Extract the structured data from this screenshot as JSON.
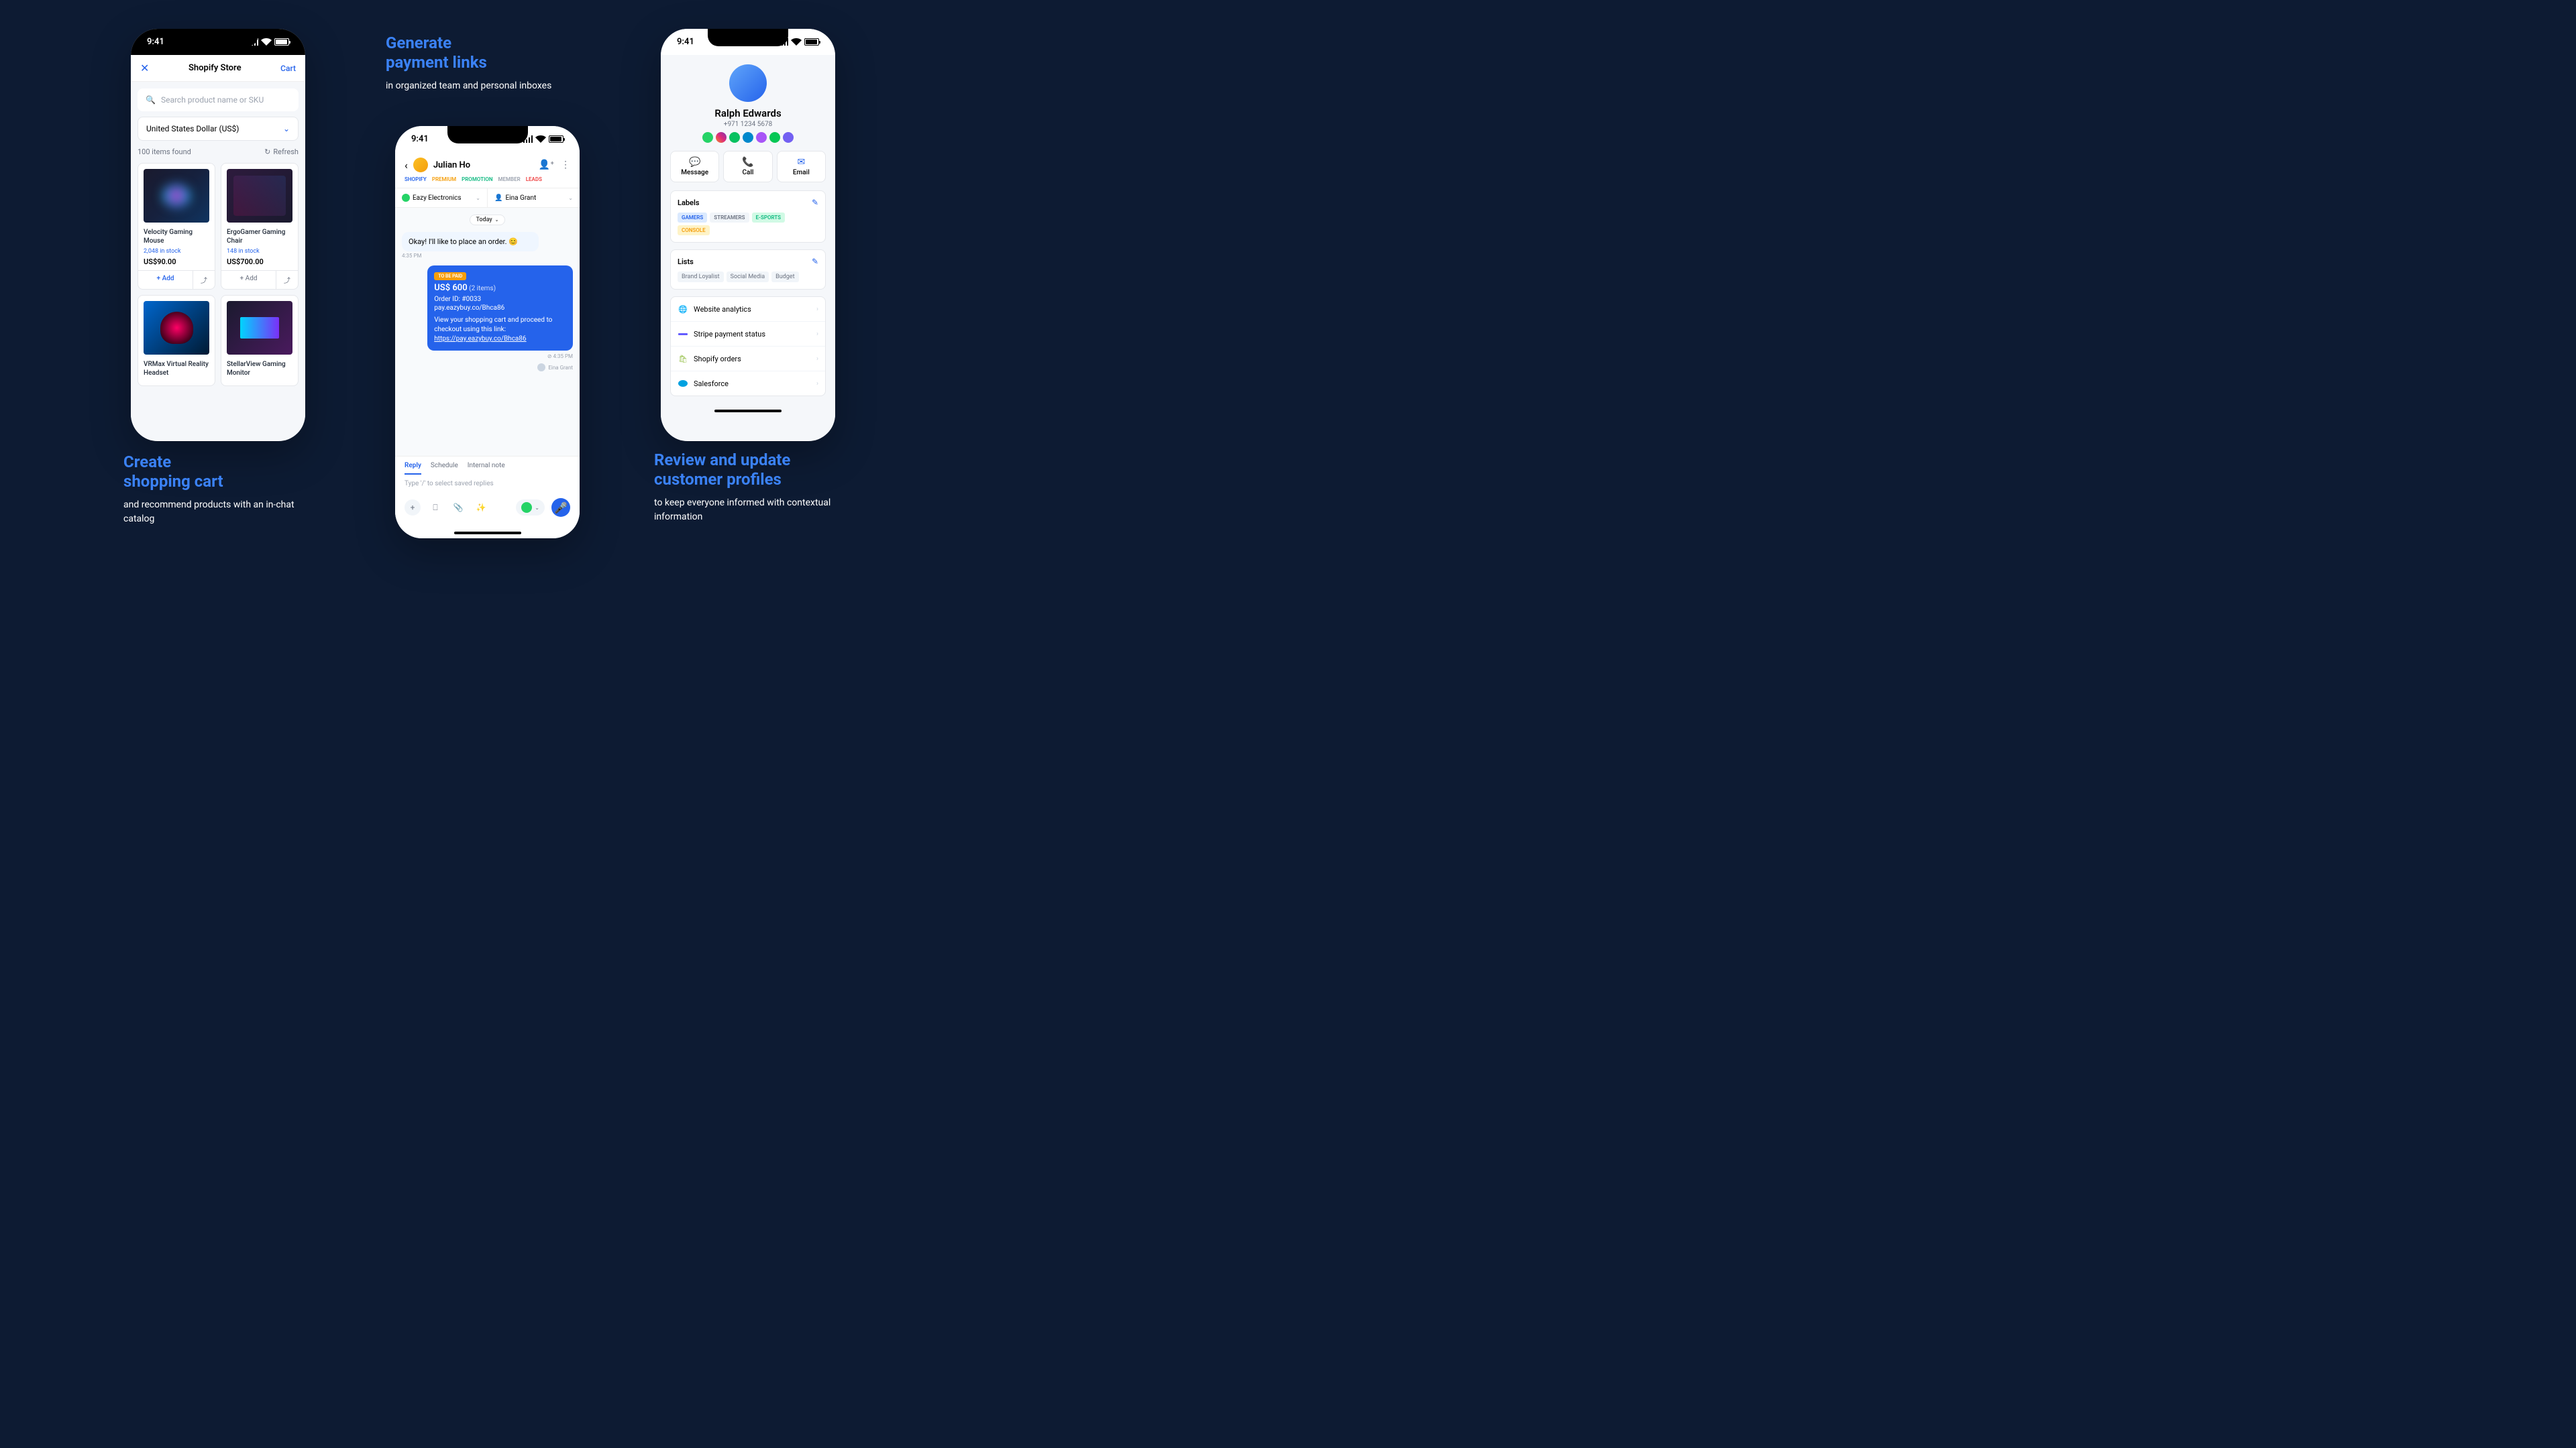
{
  "statusTime": "9:41",
  "phone1": {
    "header": {
      "title": "Shopify Store",
      "cart": "Cart"
    },
    "search": {
      "placeholder": "Search product name or SKU"
    },
    "currency": "United States Dollar (US$)",
    "itemsFound": "100 items found",
    "refresh": "Refresh",
    "products": [
      {
        "name": "Velocity Gaming Mouse",
        "stock": "2,048 in stock",
        "price": "US$90.00",
        "add": "Add"
      },
      {
        "name": "ErgoGamer Gaming Chair",
        "stock": "148 in stock",
        "price": "US$700.00",
        "add": "Add"
      },
      {
        "name": "VRMax Virtual Reality Headset",
        "stock": "",
        "price": "",
        "add": ""
      },
      {
        "name": "StellarView Gaming Monitor",
        "stock": "",
        "price": "",
        "add": ""
      }
    ]
  },
  "phone2": {
    "name": "Julian Ho",
    "tags": {
      "shopify": "SHOPIFY",
      "premium": "PREMIUM",
      "promo": "PROMOTION",
      "member": "MEMBER",
      "leads": "LEADS"
    },
    "sel1": "Eazy Electronics",
    "sel2": "Eina Grant",
    "date": "Today",
    "msgIn": "Okay! I'll like to place an order. 😊",
    "msgInTime": "4:35 PM",
    "payment": {
      "badge": "TO BE PAID",
      "amount": "US$ 600",
      "items": "(2 items)",
      "order": "Order ID: #0033",
      "link": "pay.eazybuy.co/Bhca86",
      "desc": "View your shopping cart and proceed to checkout using this link:",
      "url": "https://pay.eazybuy.co/Bhca86"
    },
    "outTime": "4:35 PM",
    "sentBy": "Eina Grant",
    "tabs": {
      "reply": "Reply",
      "schedule": "Schedule",
      "note": "Internal note"
    },
    "replyPlaceholder": "Type '/' to select saved replies"
  },
  "phone3": {
    "name": "Ralph Edwards",
    "phone": "+971 1234 5678",
    "actions": {
      "message": "Message",
      "call": "Call",
      "email": "Email"
    },
    "labels": {
      "title": "Labels",
      "items": [
        "GAMERS",
        "STREAMERS",
        "E-SPORTS",
        "CONSOLE"
      ]
    },
    "lists": {
      "title": "Lists",
      "items": [
        "Brand Loyalist",
        "Social Media",
        "Budget"
      ]
    },
    "integrations": [
      "Website analytics",
      "Stripe payment status",
      "Shopify orders",
      "Salesforce"
    ]
  },
  "captions": {
    "c1": {
      "title": "Create\nshopping cart",
      "sub": "and recommend products with an in-chat catalog"
    },
    "c2": {
      "title": "Generate\npayment links",
      "sub": "in organized team and personal inboxes"
    },
    "c3": {
      "title": "Review and update customer profiles",
      "sub": "to keep everyone informed with contextual information"
    }
  }
}
